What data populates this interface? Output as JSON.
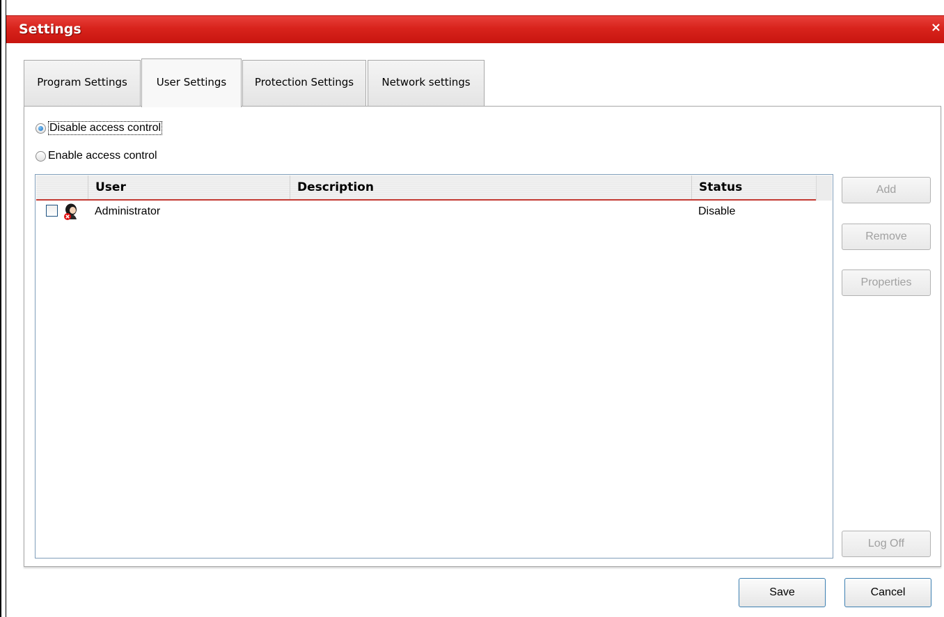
{
  "window": {
    "title": "Settings",
    "close_glyph": "×"
  },
  "tabs": [
    {
      "label": "Program Settings",
      "active": false
    },
    {
      "label": "User Settings",
      "active": true
    },
    {
      "label": "Protection Settings",
      "active": false
    },
    {
      "label": "Network settings",
      "active": false
    }
  ],
  "access_control": {
    "disable_label": "Disable access control",
    "enable_label": "Enable access control",
    "selected": "disable"
  },
  "user_list": {
    "columns": {
      "user": "User",
      "description": "Description",
      "status": "Status"
    },
    "rows": [
      {
        "checked": false,
        "icon": "user-disabled-icon",
        "user": "Administrator",
        "description": "",
        "status": "Disable"
      }
    ]
  },
  "side_buttons": {
    "add": "Add",
    "remove": "Remove",
    "properties": "Properties",
    "log_off": "Log Off"
  },
  "footer": {
    "save": "Save",
    "cancel": "Cancel"
  },
  "colors": {
    "titlebar": "#d8231c",
    "header_underline": "#c43a32",
    "button_border": "#3c7fb1"
  }
}
